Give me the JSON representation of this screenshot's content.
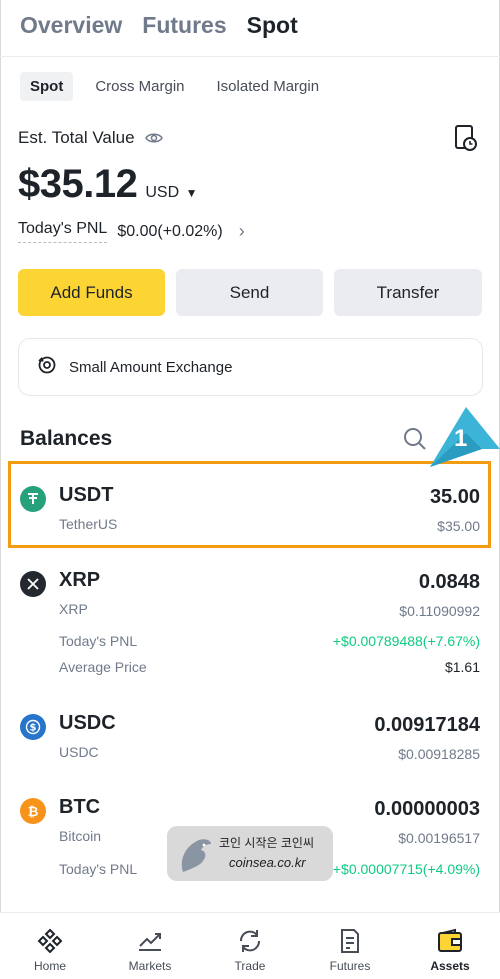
{
  "top_tabs": [
    "Overview",
    "Futures",
    "Spot"
  ],
  "sub_tabs": [
    "Spot",
    "Cross Margin",
    "Isolated Margin"
  ],
  "summary": {
    "est_label": "Est. Total Value",
    "total": "$35.12",
    "currency": "USD",
    "pnl_label": "Today's PNL",
    "pnl_value": "$0.00(+0.02%)"
  },
  "actions": {
    "add_funds": "Add Funds",
    "send": "Send",
    "transfer": "Transfer"
  },
  "small_exchange": "Small Amount Exchange",
  "balances": {
    "title": "Balances",
    "items": [
      {
        "symbol": "USDT",
        "name": "TetherUS",
        "qty": "35.00",
        "usd": "$35.00",
        "icon": "usdt-icon",
        "color": "#26a17b"
      },
      {
        "symbol": "XRP",
        "name": "XRP",
        "qty": "0.0848",
        "usd": "$0.11090992",
        "pnl_label": "Today's PNL",
        "pnl": "+$0.00789488(+7.67%)",
        "avg_label": "Average Price",
        "avg": "$1.61",
        "icon": "xrp-icon",
        "color": "#23292f"
      },
      {
        "symbol": "USDC",
        "name": "USDC",
        "qty": "0.00917184",
        "usd": "$0.00918285",
        "icon": "usdc-icon",
        "color": "#2775ca"
      },
      {
        "symbol": "BTC",
        "name": "Bitcoin",
        "qty": "0.00000003",
        "usd": "$0.00196517",
        "pnl_label": "Today's PNL",
        "pnl": "+$0.00007715(+4.09%)",
        "icon": "btc-icon",
        "color": "#f7931a"
      }
    ]
  },
  "annotation": "1",
  "watermark": {
    "line1": "코인 시작은 코인씨",
    "line2": "coinsea.co.kr"
  },
  "nav": [
    "Home",
    "Markets",
    "Trade",
    "Futures",
    "Assets"
  ],
  "colors": {
    "accent": "#fcd535",
    "positive": "#0ecb81",
    "highlight": "#f39c12",
    "annotation": "#3bb4d8"
  }
}
